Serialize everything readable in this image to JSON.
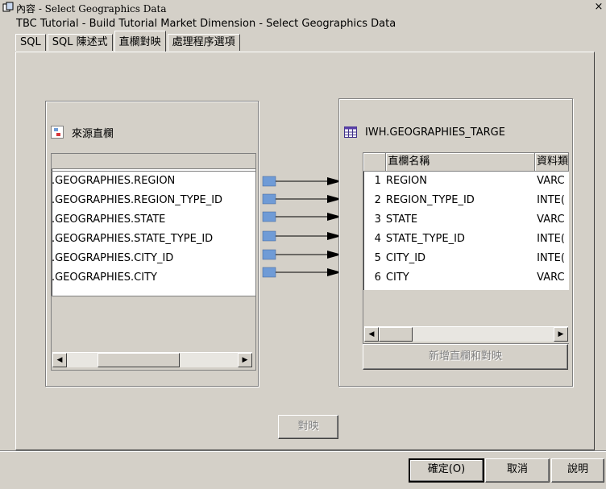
{
  "window": {
    "title": "內容 - Select Geographics Data",
    "close_label": "×"
  },
  "subtitle": "TBC Tutorial - Build Tutorial Market Dimension - Select Geographics Data",
  "tabs": [
    {
      "label": "SQL",
      "active": false
    },
    {
      "label": "SQL 陳述式",
      "active": false
    },
    {
      "label": "直欄對映",
      "active": true
    },
    {
      "label": "處理程序選項",
      "active": false
    }
  ],
  "source_panel": {
    "title": "來源直欄",
    "icon": "source-columns-icon",
    "columns": [
      ".GEOGRAPHIES.REGION",
      ".GEOGRAPHIES.REGION_TYPE_ID",
      ".GEOGRAPHIES.STATE",
      ".GEOGRAPHIES.STATE_TYPE_ID",
      ".GEOGRAPHIES.CITY_ID",
      ".GEOGRAPHIES.CITY"
    ]
  },
  "target_panel": {
    "title": "IWH.GEOGRAPHIES_TARGE",
    "icon": "table-icon",
    "col_headers": [
      "直欄名稱",
      "資料類"
    ],
    "rows": [
      {
        "num": "1",
        "name": "REGION",
        "type": "VARC"
      },
      {
        "num": "2",
        "name": "REGION_TYPE_ID",
        "type": "INTE("
      },
      {
        "num": "3",
        "name": "STATE",
        "type": "VARC"
      },
      {
        "num": "4",
        "name": "STATE_TYPE_ID",
        "type": "INTE("
      },
      {
        "num": "5",
        "name": "CITY_ID",
        "type": "INTE("
      },
      {
        "num": "6",
        "name": "CITY",
        "type": "VARC"
      }
    ],
    "add_button": "新增直欄和對映"
  },
  "map_button": "對映",
  "buttons": {
    "ok": "確定(O)",
    "cancel": "取消",
    "help": "說明"
  },
  "colors": {
    "source_marker": "#6f9bd6",
    "target_marker": "#d9373a"
  }
}
